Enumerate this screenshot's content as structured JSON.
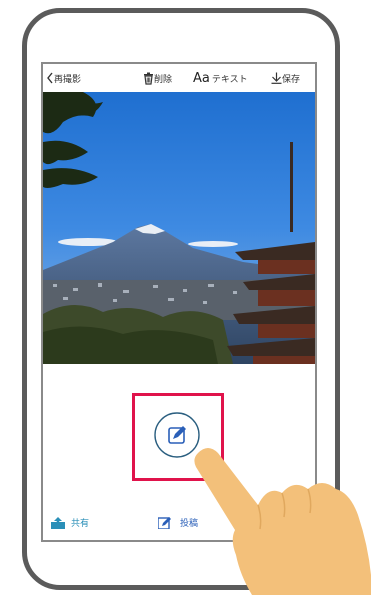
{
  "topbar": {
    "back_label": "再撮影",
    "delete_label": "削除",
    "text_prefix": "Aa",
    "text_label": "テキスト",
    "save_label": "保存"
  },
  "bottom": {
    "share_label": "共有",
    "post_label": "投稿"
  },
  "colors": {
    "highlight": "#e0134b",
    "accent": "#2a8fb8"
  }
}
